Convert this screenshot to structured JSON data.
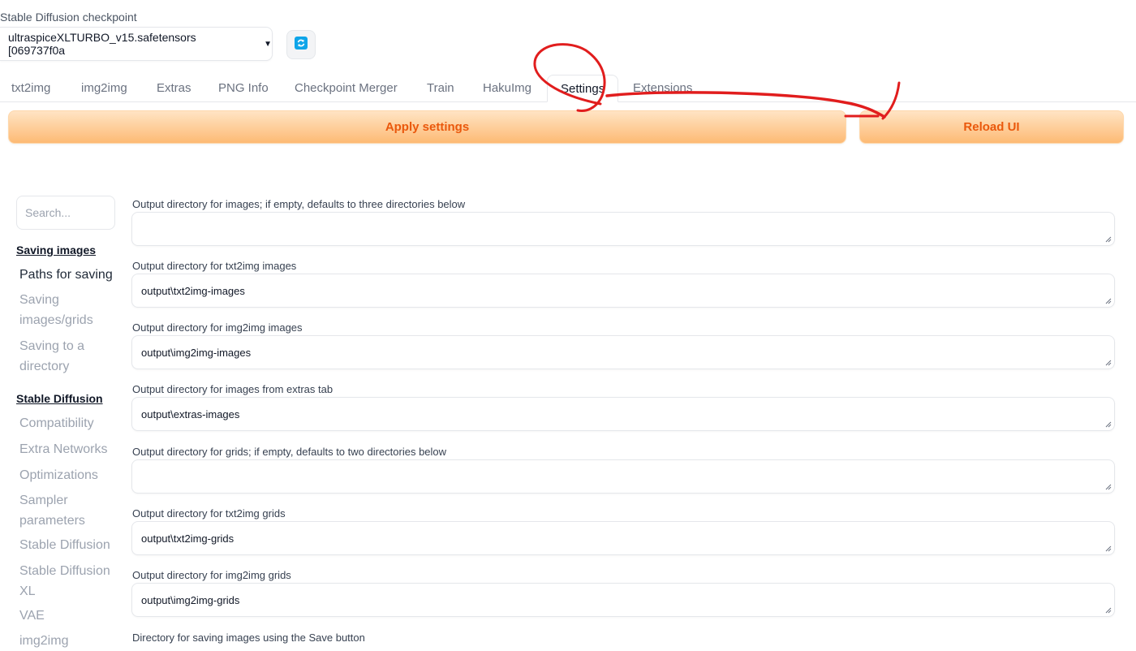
{
  "checkpoint": {
    "label": "Stable Diffusion checkpoint",
    "value": "ultraspiceXLTURBO_v15.safetensors [069737f0a",
    "caret": "▼"
  },
  "tabs": [
    {
      "label": "txt2img"
    },
    {
      "label": "img2img"
    },
    {
      "label": "Extras"
    },
    {
      "label": "PNG Info"
    },
    {
      "label": "Checkpoint Merger"
    },
    {
      "label": "Train"
    },
    {
      "label": "HakuImg"
    },
    {
      "label": "Settings"
    },
    {
      "label": "Extensions"
    }
  ],
  "actions": {
    "apply": "Apply settings",
    "reload": "Reload UI"
  },
  "sidebar": {
    "search_placeholder": "Search...",
    "sections": [
      {
        "title": "Saving images",
        "items": [
          "Paths for saving",
          "Saving images/grids",
          "Saving to a directory"
        ]
      },
      {
        "title": "Stable Diffusion",
        "items": [
          "Compatibility",
          "Extra Networks",
          "Optimizations",
          "Sampler parameters",
          "Stable Diffusion",
          "Stable Diffusion XL",
          "VAE",
          "img2img"
        ]
      }
    ]
  },
  "fields": [
    {
      "label": "Output directory for images; if empty, defaults to three directories below",
      "value": ""
    },
    {
      "label": "Output directory for txt2img images",
      "value": "output\\txt2img-images"
    },
    {
      "label": "Output directory for img2img images",
      "value": "output\\img2img-images"
    },
    {
      "label": "Output directory for images from extras tab",
      "value": "output\\extras-images"
    },
    {
      "label": "Output directory for grids; if empty, defaults to two directories below",
      "value": ""
    },
    {
      "label": "Output directory for txt2img grids",
      "value": "output\\txt2img-grids"
    },
    {
      "label": "Output directory for img2img grids",
      "value": "output\\img2img-grids"
    },
    {
      "label": "Directory for saving images using the Save button",
      "value": ""
    }
  ],
  "colors": {
    "accent_orange": "#ea580c",
    "button_gradient_top": "#ffe4c4",
    "button_gradient_bottom": "#fdba74",
    "refresh_icon": "#0ea5e9",
    "annotation_red": "#e11d1d"
  },
  "icons": {
    "refresh": "refresh-icon",
    "caret": "chevron-down-icon"
  }
}
